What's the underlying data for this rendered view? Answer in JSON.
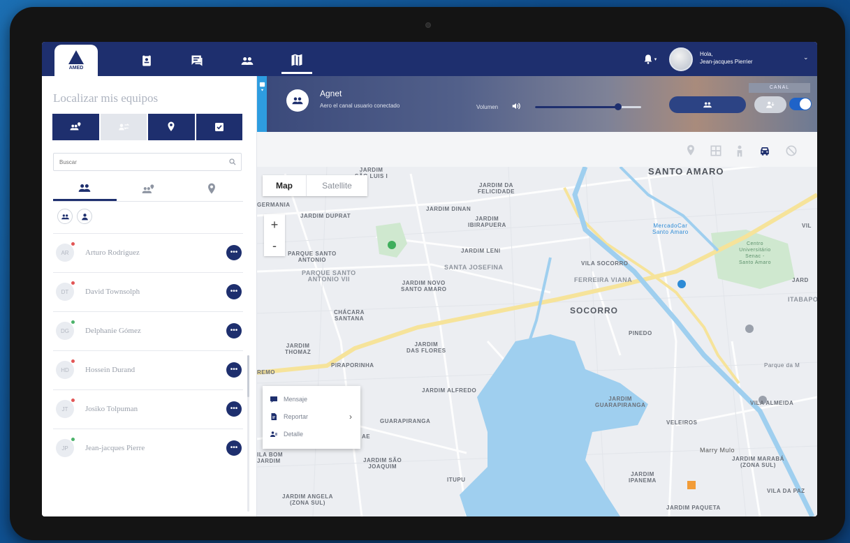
{
  "brand": {
    "logo_text": "AMED"
  },
  "topbar": {
    "nav": [
      {
        "name": "contacts-nav",
        "icon": "contact-card-icon"
      },
      {
        "name": "messages-nav",
        "icon": "chat-icon"
      },
      {
        "name": "groups-nav",
        "icon": "group-icon"
      },
      {
        "name": "map-nav",
        "icon": "map-icon",
        "active": true
      }
    ],
    "greeting": "Hola,",
    "user_name": "Jean-jacques Pierrier"
  },
  "sidebar": {
    "title": "Localizar mis equipos",
    "search_placeholder": "Buscar",
    "users": [
      {
        "initials": "AR",
        "name": "Arturo Rodriguez",
        "status_color": "#e25656"
      },
      {
        "initials": "DT",
        "name": "David Townsolph",
        "status_color": "#e25656"
      },
      {
        "initials": "DG",
        "name": "Delphanie Gómez",
        "status_color": "#4cb26a"
      },
      {
        "initials": "HD",
        "name": "Hossein Durand",
        "status_color": "#e25656"
      },
      {
        "initials": "JT",
        "name": "Josiko Tolpuman",
        "status_color": "#e25656"
      },
      {
        "initials": "JP",
        "name": "Jean-jacques Pierre",
        "status_color": "#4cb26a"
      }
    ],
    "more_label": "•••"
  },
  "channel": {
    "name": "Agnet",
    "subtitle": "Aero el canal usuario conectado",
    "volume_label": "Volumen",
    "volume_level": 0.78,
    "canal_label": "CANAL",
    "toggle_on": true
  },
  "map": {
    "type_map": "Map",
    "type_satellite": "Satellite",
    "zoom_in": "+",
    "zoom_out": "-",
    "labels": {
      "santo_amaro": "SANTO AMARO",
      "socorro": "SOCORRO",
      "jardim_sao_luis": "JARDIM\nSÃO LUIS I",
      "jardim_da_felicidade": "JARDIM DA\nFELICIDADE",
      "germania": "GERMANIA",
      "jardim_dinan": "JARDIM DINAN",
      "jardim_dupret": "JARDIM DUPRAT",
      "jardim_ibirapuera": "JARDIM\nIBIRAPUERA",
      "parque_santo_antonio": "PARQUE SANTO\nANTONIO",
      "parque_santo_antonio_vii": "PARQUE SANTO\nANTONIO VII",
      "jardim_leni": "JARDIM LENI",
      "santa_josefina": "SANTA JOSEFINA",
      "jardim_novo_santo_amaro": "JARDIM NOVO\nSANTO AMARO",
      "vila_socorro": "VILA SOCORRO",
      "ferreira_viana": "FERREIRA VIANA",
      "mercado_santo_amaro": "MercadoCar\nSanto Amaro",
      "centro_universitario": "Centro\nUniversitário\nSenac -\nSanto Amaro",
      "chacara_santana": "CHÁCARA\nSANTANA",
      "pinedo": "PINEDO",
      "itabapoa": "ITABAPO",
      "jardim_thomaz": "JARDIM\nTHOMAZ",
      "jardim_das_flores": "JARDIM\nDAS FLORES",
      "piraporinha": "PIRAPORINHA",
      "remo": "REMO",
      "jardim_alfredo": "JARDIM ALFREDO",
      "jardim_guarapiranga": "JARDIM\nGUARAPIRANGA",
      "vila_almeida": "VILA ALMEIDA",
      "parque_m": "Parque da M",
      "veleiros": "VELEIROS",
      "guarapiranga": "GUARAPIRANGA",
      "marry_mulo": "Marry Mulo",
      "jardim_maraba": "JARDIM MARABÁ\n(ZONA SUL)",
      "vila_bom_jardim": "ILA BOM\nJARDIM",
      "jardim_sao_joaquim": "JARDIM SÃO\nJOAQUIM",
      "itupu": "ITUPU",
      "jardim_ipanema": "JARDIM\nIPANEMA",
      "vila_da_paz": "VILA DA PAZ",
      "jardim_angela": "JARDIM ANGELA\n(ZONA SUL)",
      "jardim_paqueta": "JARDIM PAQUETA",
      "jard": "JARD",
      "vila": "VIL",
      "ae": "AE"
    },
    "context_menu": [
      {
        "label": "Mensaje",
        "icon": "message-icon"
      },
      {
        "label": "Reportar",
        "icon": "report-icon",
        "has_submenu": true
      },
      {
        "label": "Detalle",
        "icon": "detail-icon"
      }
    ]
  },
  "colors": {
    "navy": "#1e2f6e",
    "accent_blue": "#2e9de0",
    "water": "#9fcfef",
    "road_yellow": "#f6e39a",
    "park_green": "#cfe8cf"
  }
}
